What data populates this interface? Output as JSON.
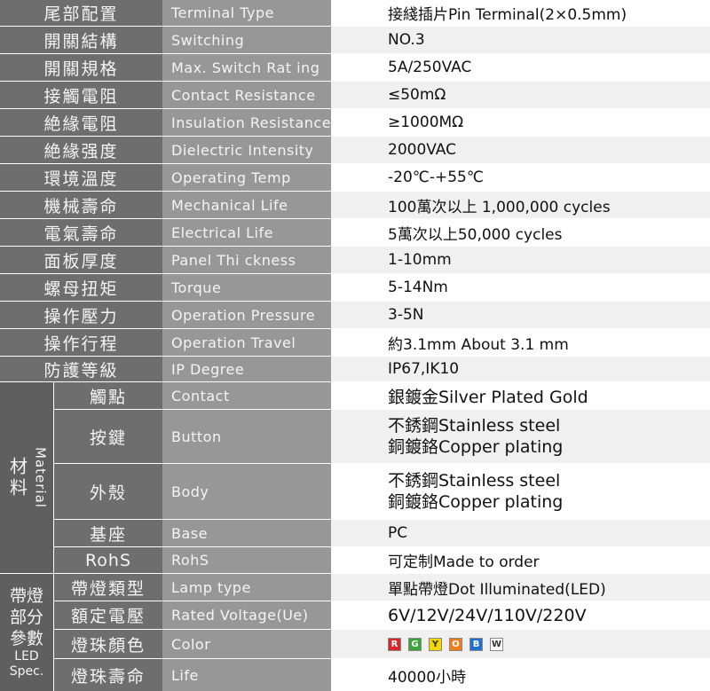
{
  "rows": [
    {
      "zh": "尾部配置",
      "en": "Terminal Type",
      "value": "接綫插片Pin Terminal(2×0.5mm)"
    },
    {
      "zh": "開關結構",
      "en": "Switching",
      "value": "NO.3"
    },
    {
      "zh": "開關規格",
      "en": "Max. Switch Rat ing",
      "value": "5A/250VAC"
    },
    {
      "zh": "接觸電阻",
      "en": "Contact Resistance",
      "value": "≤50mΩ"
    },
    {
      "zh": "絶緣電阻",
      "en": "Insulation Resistance",
      "value": "≥1000MΩ"
    },
    {
      "zh": "絶緣强度",
      "en": "Dielectric Intensity",
      "value": "2000VAC"
    },
    {
      "zh": "環境溫度",
      "en": "Operating Temp",
      "value": "-20℃-+55℃"
    },
    {
      "zh": "機械壽命",
      "en": "Mechanical Life",
      "value": "100萬次以上 1,000,000 cycles"
    },
    {
      "zh": "電氣壽命",
      "en": "Electrical Life",
      "value": "5萬次以上50,000 cycles"
    },
    {
      "zh": "面板厚度",
      "en": "Panel Thi ckness",
      "value": "1-10mm"
    },
    {
      "zh": "螺母扭矩",
      "en": "Torque",
      "value": "5-14Nm"
    },
    {
      "zh": "操作壓力",
      "en": "Operation Pressure",
      "value": "3-5N"
    },
    {
      "zh": "操作行程",
      "en": "Operation Travel",
      "value": "約3.1mm  About 3.1 mm"
    },
    {
      "zh": "防護等級",
      "en": "IP Degree",
      "value": "IP67,IK10"
    }
  ],
  "material_group": {
    "zh": "材料",
    "en": "Material",
    "rows": [
      {
        "zh": "觸點",
        "en": "Contact",
        "value": "銀鍍金Silver Plated Gold"
      },
      {
        "zh": "按鍵",
        "en": "Button",
        "line1": "不銹鋼Stainless steel",
        "line2": "銅鍍鉻Copper plating"
      },
      {
        "zh": "外殼",
        "en": "Body",
        "line1": "不銹鋼Stainless steel",
        "line2": "銅鍍鉻Copper plating"
      },
      {
        "zh": "基座",
        "en": "Base",
        "value": "PC"
      },
      {
        "zh": "RohS",
        "en": "RohS",
        "value": "可定制Made to order"
      }
    ]
  },
  "led_group": {
    "zh": "帶燈部分參數",
    "zh1": "帶燈",
    "zh2": "部分",
    "zh3": "參數",
    "en1": "LED",
    "en2": "Spec.",
    "rows": [
      {
        "zh": "帶燈類型",
        "en": "Lamp type",
        "value": "單點帶燈Dot Illuminated(LED)"
      },
      {
        "zh": "額定電壓",
        "en": "Rated Voltage(Ue)",
        "value": "6V/12V/24V/110V/220V"
      },
      {
        "zh": "燈珠顏色",
        "en": "Color",
        "colors": [
          {
            "letter": "R",
            "color": "#d9262b"
          },
          {
            "letter": "G",
            "color": "#3aa63a"
          },
          {
            "letter": "Y",
            "color": "#f0d800"
          },
          {
            "letter": "O",
            "color": "#ef7d1a"
          },
          {
            "letter": "B",
            "color": "#1f6fd1"
          },
          {
            "letter": "W",
            "color": "#ffffff"
          }
        ]
      },
      {
        "zh": "燈珠壽命",
        "en": "Life",
        "value": "40000小時"
      }
    ]
  }
}
